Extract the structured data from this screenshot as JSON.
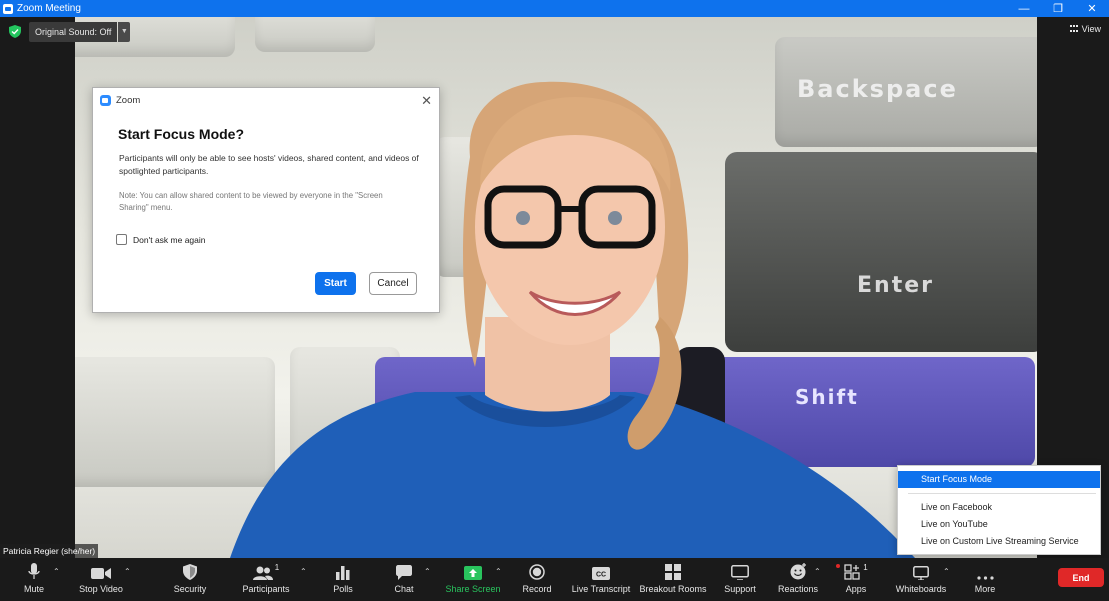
{
  "window": {
    "title": "Zoom Meeting",
    "controls": [
      "minimize-icon",
      "restore-icon",
      "close-icon"
    ]
  },
  "top_bar": {
    "original_sound": "Original Sound: Off",
    "view_label": "View"
  },
  "dialog": {
    "app_name": "Zoom",
    "title": "Start Focus Mode?",
    "body": "Participants will only be able to see hosts' videos, shared content, and videos of spotlighted participants.",
    "note": "Note: You can allow shared content to be viewed by everyone in the \"Screen Sharing\" menu.",
    "checkbox_label": "Don't ask me again",
    "checkbox_checked": false,
    "start_label": "Start",
    "cancel_label": "Cancel"
  },
  "video": {
    "participant_name": "Patricia Regier (she/her)",
    "keys": [
      "Backspace",
      "Enter",
      "Shift"
    ]
  },
  "more_menu": {
    "items": [
      {
        "label": "Start Focus Mode",
        "active": true
      },
      {
        "label": "Live on Facebook",
        "active": false
      },
      {
        "label": "Live on YouTube",
        "active": false
      },
      {
        "label": "Live on Custom Live Streaming Service",
        "active": false
      }
    ]
  },
  "toolbar": {
    "mute": "Mute",
    "stop_video": "Stop Video",
    "security": "Security",
    "participants": "Participants",
    "participants_count": "1",
    "polls": "Polls",
    "chat": "Chat",
    "share_screen": "Share Screen",
    "record": "Record",
    "live_transcript": "Live Transcript",
    "breakout_rooms": "Breakout Rooms",
    "support": "Support",
    "reactions": "Reactions",
    "apps": "Apps",
    "apps_count": "1",
    "whiteboards": "Whiteboards",
    "more": "More",
    "end": "End"
  },
  "colors": {
    "zoom_blue": "#0e72ed",
    "end_red": "#e02828",
    "share_green": "#29c45e",
    "toolbar_bg": "#1a1a1a"
  }
}
